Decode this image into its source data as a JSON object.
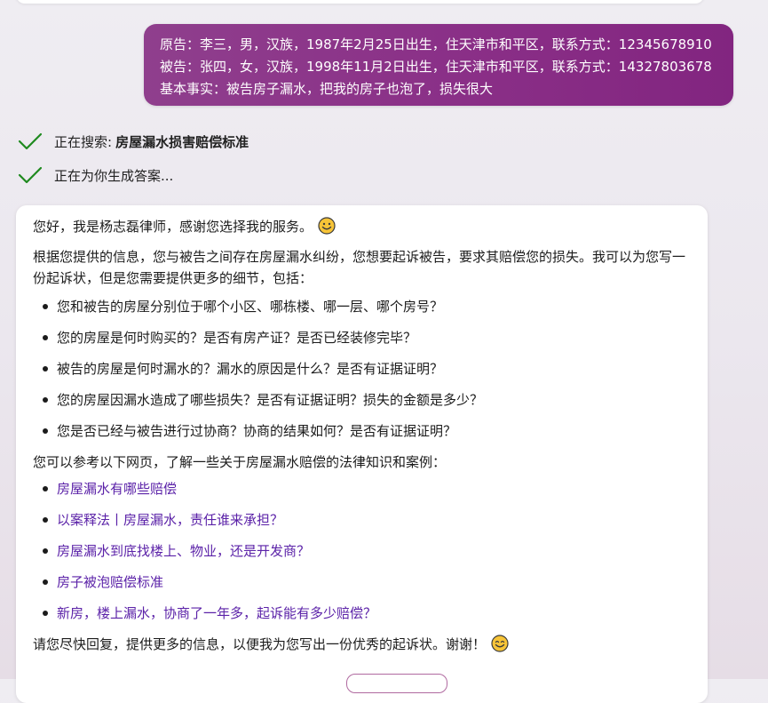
{
  "user_message": {
    "lines": [
      "原告：李三，男，汉族，1987年2月25日出生，住天津市和平区，联系方式：12345678910",
      "被告：张四，女，汉族，1998年11月2日出生，住天津市和平区，联系方式：14327803678",
      "基本事实：被告房子漏水，把我的房子也泡了，损失很大"
    ]
  },
  "status": {
    "searching_label": "正在搜索:",
    "search_query": "房屋漏水损害赔偿标准",
    "generating_label": "正在为你生成答案..."
  },
  "answer": {
    "greeting": "您好，我是杨志磊律师，感谢您选择我的服务。",
    "intro": "根据您提供的信息，您与被告之间存在房屋漏水纠纷，您想要起诉被告，要求其赔偿您的损失。我可以为您写一份起诉状，但是您需要提供更多的细节，包括：",
    "questions": [
      "您和被告的房屋分别位于哪个小区、哪栋楼、哪一层、哪个房号？",
      "您的房屋是何时购买的？是否有房产证？是否已经装修完毕？",
      "被告的房屋是何时漏水的？漏水的原因是什么？是否有证据证明？",
      "您的房屋因漏水造成了哪些损失？是否有证据证明？损失的金额是多少？",
      "您是否已经与被告进行过协商？协商的结果如何？是否有证据证明？"
    ],
    "links_intro": "您可以参考以下网页，了解一些关于房屋漏水赔偿的法律知识和案例：",
    "links": [
      "房屋漏水有哪些赔偿",
      "以案释法丨房屋漏水，责任谁来承担？",
      "房屋漏水到底找楼上、物业，还是开发商？",
      "房子被泡赔偿标准",
      "新房，楼上漏水，协商了一年多，起诉能有多少赔偿？"
    ],
    "closing": "请您尽快回复，提供更多的信息，以便我为您写出一份优秀的起诉状。谢谢！"
  },
  "colors": {
    "user_bubble": "#8a2f87",
    "check_green": "#1f8a1f",
    "link_purple": "#5b22a8"
  },
  "icons": {
    "status_check": "check-icon",
    "emoji": "smiling-face-emoji"
  }
}
